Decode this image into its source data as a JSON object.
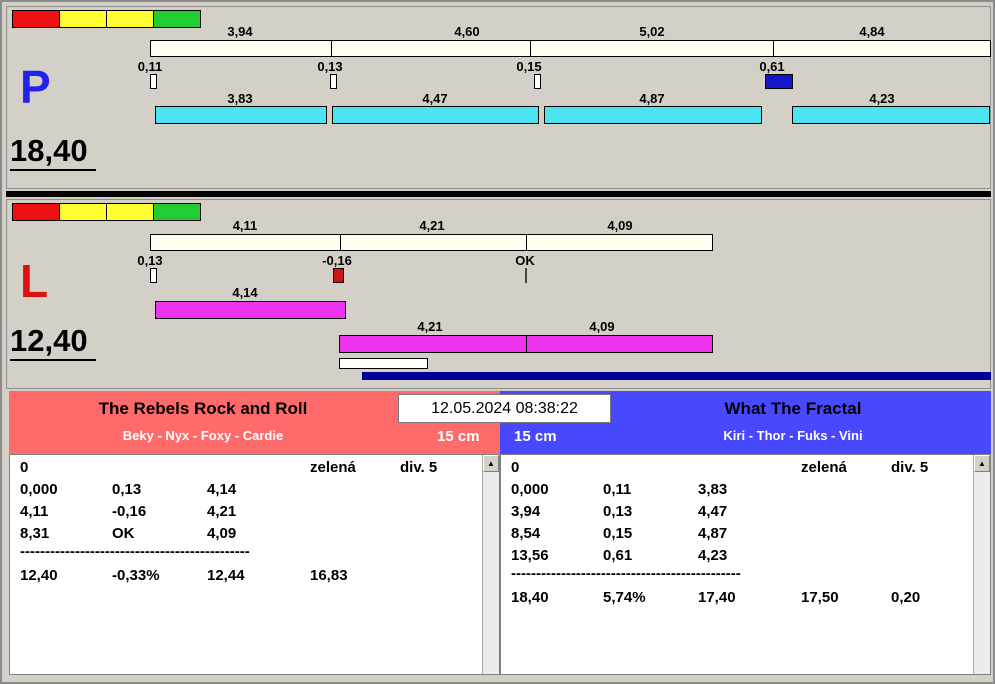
{
  "colors": {
    "window_bg": "#d4d0c8",
    "cream_bar": "#fffff0",
    "cyan_bar": "#4de4f2",
    "magenta_bar": "#ee33ee",
    "blue_mark": "#1515cc",
    "red_mark": "#cc1515",
    "navy_bar": "#000099",
    "left_header_bg": "#ff6b6b",
    "right_header_bg": "#4848ff",
    "lane_p_color": "#2222ee",
    "lane_l_color": "#dd1111"
  },
  "datetime": "12.05.2024 08:38:22",
  "lane_p": {
    "letter": "P",
    "total": "18,40",
    "lights": [
      "#ee1111",
      "#ffff33",
      "#ffff33",
      "#22cc33"
    ],
    "leg_times": [
      "3,94",
      "4,60",
      "5,02",
      "4,84"
    ],
    "cross_times": [
      "0,11",
      "0,13",
      "0,15",
      "0,61"
    ],
    "dog_times": [
      "3,83",
      "4,47",
      "4,87",
      "4,23"
    ]
  },
  "lane_l": {
    "letter": "L",
    "total": "12,40",
    "lights": [
      "#ee1111",
      "#ffff33",
      "#ffff33",
      "#22cc33"
    ],
    "leg_times": [
      "4,11",
      "4,21",
      "4,09"
    ],
    "cross_times": [
      "0,13",
      "-0,16",
      "OK"
    ],
    "dog_time_first": "4,14",
    "dog_times_rest": [
      "4,21",
      "4,09"
    ]
  },
  "left_team": {
    "name": "The Rebels Rock and Roll",
    "dogs": "Beky - Nyx - Foxy - Cardie",
    "jump_height": "15 cm",
    "table": {
      "status_row": {
        "num": "0",
        "color": "zelená",
        "division": "div. 5"
      },
      "rows": [
        [
          "0,000",
          "0,13",
          "4,14"
        ],
        [
          "4,11",
          "-0,16",
          "4,21"
        ],
        [
          "8,31",
          "OK",
          "4,09"
        ]
      ],
      "separator": "----------------------------------------------",
      "summary": [
        "12,40",
        "-0,33%",
        "12,44",
        "16,83"
      ]
    }
  },
  "right_team": {
    "name": "What The Fractal",
    "dogs": "Kiri - Thor - Fuks - Vini",
    "jump_height": "15 cm",
    "table": {
      "status_row": {
        "num": "0",
        "color": "zelená",
        "division": "div. 5"
      },
      "rows": [
        [
          "0,000",
          "0,11",
          "3,83"
        ],
        [
          "3,94",
          "0,13",
          "4,47"
        ],
        [
          "8,54",
          "0,15",
          "4,87"
        ],
        [
          "13,56",
          "0,61",
          "4,23"
        ]
      ],
      "separator": "----------------------------------------------",
      "summary": [
        "18,40",
        "5,74%",
        "17,40",
        "17,50",
        "0,20"
      ]
    }
  },
  "scrollbar": {
    "up_arrow": "▲"
  }
}
